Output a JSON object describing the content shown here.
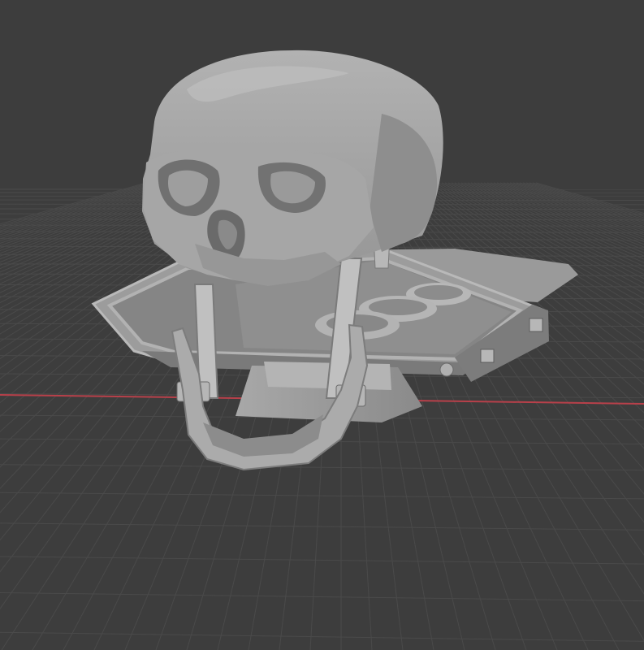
{
  "viewport": {
    "background_color": "#3d3d3d",
    "grid_line_color": "#4a4a4a",
    "x_axis_color": "#b8404a",
    "model_color": "#a2a2a2",
    "model_shadow_color": "#6e6e6e",
    "model_highlight_color": "#c4c4c4",
    "model_name": "skull-on-display-stand"
  }
}
